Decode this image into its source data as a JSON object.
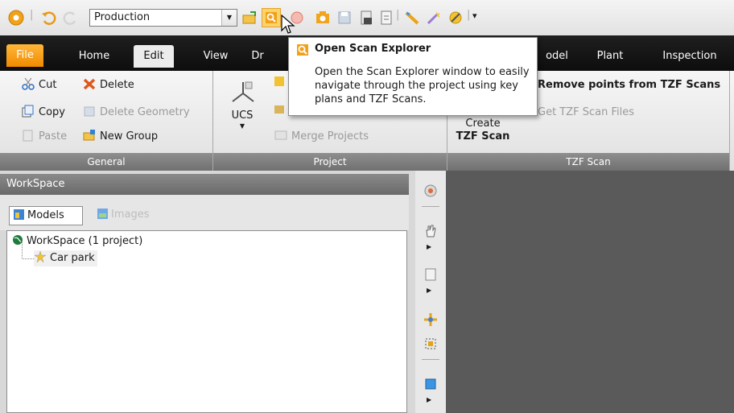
{
  "qat": {
    "project_value": "Production",
    "icons": [
      "app-icon",
      "undo-icon",
      "redo-icon",
      "open-project-icon",
      "scan-explorer-icon",
      "scan-icon",
      "camera-icon",
      "save-icon",
      "export-icon",
      "document-icon",
      "measure-icon",
      "wand-icon",
      "settings-icon",
      "customize-icon"
    ]
  },
  "tabs": [
    "File",
    "Home",
    "Edit",
    "View",
    "Dr",
    "odel",
    "Plant",
    "Inspection"
  ],
  "ribbon": {
    "general": {
      "label": "General",
      "cut": "Cut",
      "delete": "Delete",
      "copy": "Copy",
      "delete_geometry": "Delete Geometry",
      "paste": "Paste",
      "new_group": "New Group"
    },
    "project": {
      "label": "Project",
      "ucs": "UCS",
      "merge_projects": "Merge Projects"
    },
    "tzf": {
      "label": "TZF Scan",
      "create_line1": "Create",
      "create_line2": "TZF Scan",
      "remove_points": "Remove points from TZF Scans",
      "get_files": "Get TZF Scan Files"
    }
  },
  "tooltip": {
    "title": "Open Scan Explorer",
    "body": "Open the Scan Explorer window to easily navigate through the project using key plans and TZF Scans."
  },
  "workspace": {
    "header": "WorkSpace",
    "tab_models": "Models",
    "tab_images": "Images",
    "root": "WorkSpace  (1 project)",
    "child": "Car park"
  }
}
